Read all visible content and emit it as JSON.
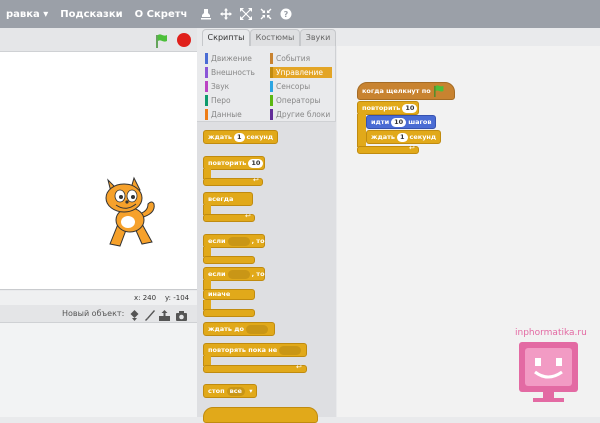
{
  "menubar": {
    "items": [
      "равка ▾",
      "Подсказки",
      "О Скретч"
    ]
  },
  "stage": {
    "x_label": "x: 240",
    "y_label": "y: -104"
  },
  "sprites": {
    "new_object_label": "Новый объект:"
  },
  "tabs": [
    "Скрипты",
    "Костюмы",
    "Звуки"
  ],
  "categories": [
    {
      "label": "Движение",
      "color": "#4a6cd4"
    },
    {
      "label": "Внешность",
      "color": "#8a55d7"
    },
    {
      "label": "Звук",
      "color": "#bb42c3"
    },
    {
      "label": "Перо",
      "color": "#0e9a6c"
    },
    {
      "label": "Данные",
      "color": "#ee7d16"
    },
    {
      "label": "События",
      "color": "#c88330"
    },
    {
      "label": "Управление",
      "color": "#e1a91a"
    },
    {
      "label": "Сенсоры",
      "color": "#2ca5e2"
    },
    {
      "label": "Операторы",
      "color": "#5cb712"
    },
    {
      "label": "Другие блоки",
      "color": "#632d99"
    }
  ],
  "palette_blocks": {
    "wait": {
      "prefix": "ждать",
      "value": "1",
      "suffix": "секунд"
    },
    "repeat": {
      "prefix": "повторить",
      "value": "10"
    },
    "forever": "всегда",
    "if_then": {
      "prefix": "если",
      "suffix": ", то"
    },
    "if_then_else": {
      "prefix": "если",
      "suffix": ", то",
      "else": "иначе"
    },
    "wait_until": "ждать до",
    "repeat_until": "повторять пока не",
    "stop": {
      "prefix": "стоп",
      "value": "все"
    }
  },
  "script": {
    "hat": "когда щелкнут по",
    "repeat": {
      "prefix": "повторить",
      "value": "10"
    },
    "move": {
      "prefix": "идти",
      "value": "10",
      "suffix": "шагов"
    },
    "wait": {
      "prefix": "ждать",
      "value": "1",
      "suffix": "секунд"
    }
  },
  "watermark": "inphormatika.ru",
  "colors": {
    "control": "#e1a91a",
    "motion": "#4a6cd4",
    "events": "#c88330",
    "flag": "#4cbf3a",
    "stop": "#e0201b"
  }
}
